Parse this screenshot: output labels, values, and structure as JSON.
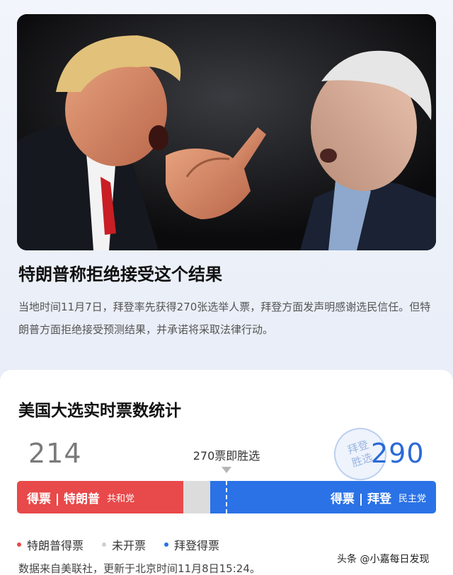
{
  "headline": "特朗普称拒绝接受这个结果",
  "summary": "当地时间11月7日，拜登率先获得270张选举人票，拜登方面发声明感谢选民信任。但特朗普方面拒绝接受预测结果，并承诺将采取法律行动。",
  "stats": {
    "title": "美国大选实时票数统计",
    "trump_count": "214",
    "biden_count": "290",
    "threshold_text": "270票即胜选",
    "stamp_line1": "拜登",
    "stamp_line2": "胜选",
    "trump_votes": 214,
    "biden_votes": 290,
    "total_votes": 538,
    "bar_left_label": "得票 | 特朗普",
    "bar_left_party": "共和党",
    "bar_right_label": "得票 | 拜登",
    "bar_right_party": "民主党",
    "colors": {
      "trump": "#e8494a",
      "biden": "#2a72e6",
      "undecided": "#dcdcdc"
    }
  },
  "legend": [
    {
      "label": "特朗普得票",
      "color": "#e8494a"
    },
    {
      "label": "未开票",
      "color": "#cfcfcf"
    },
    {
      "label": "拜登得票",
      "color": "#2a72e6"
    }
  ],
  "source": "数据来自美联社，更新于北京时间11月8日15:24。",
  "watermark": "头条 @小嘉每日发现"
}
